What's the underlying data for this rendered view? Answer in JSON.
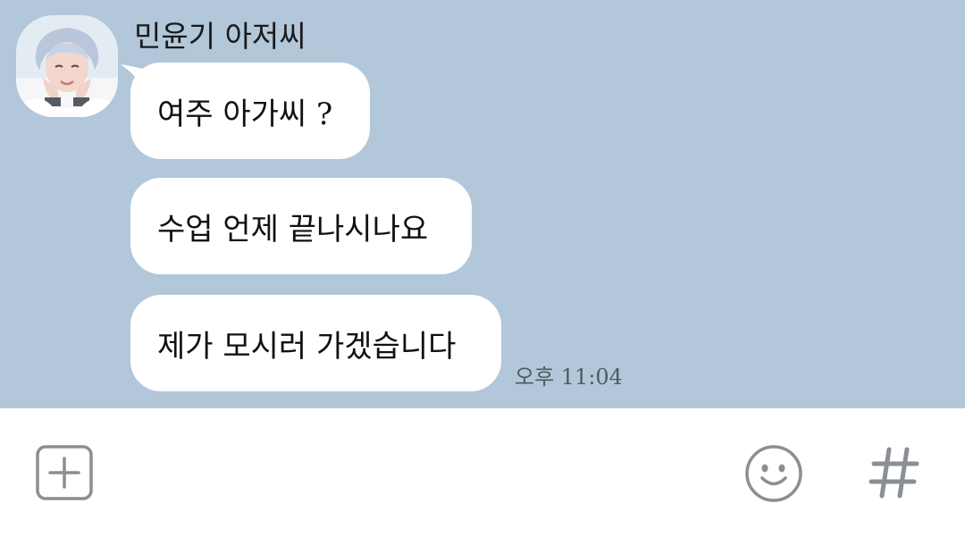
{
  "contact": {
    "name": "민윤기 아저씨",
    "avatar": "profile-photo"
  },
  "messages": [
    {
      "text": "여주 아가씨 ?"
    },
    {
      "text": "수업 언제 끝나시나요"
    },
    {
      "text": "제가 모시러 가겠습니다"
    }
  ],
  "timestamp": "오후 11:04",
  "input_bar": {
    "icons": [
      "plus-square-icon",
      "smiley-icon",
      "hash-icon"
    ]
  },
  "colors": {
    "chat_background": "#b2c7d9",
    "bubble": "#ffffff",
    "icon": "#8a8f94"
  }
}
